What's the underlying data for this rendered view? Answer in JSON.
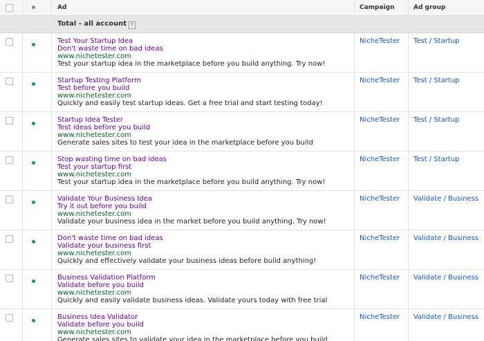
{
  "columns": {
    "ad": "Ad",
    "campaign": "Campaign",
    "ad_group": "Ad group"
  },
  "total": {
    "label": "Total - all account",
    "help": "?"
  },
  "rows": [
    {
      "headline1": "Test Your Startup Idea",
      "headline2": "Don't waste time on bad ideas",
      "url": "www.nichetester.com",
      "description": "Test your startup idea in the marketplace before you build anything. Try now!",
      "campaign": "NicheTester",
      "ad_group": "Test / Startup"
    },
    {
      "headline1": "Startup Testing Platform",
      "headline2": "Test before you build",
      "url": "www.nichetester.com",
      "description": "Quickly and easily test startup ideas. Get a free trial and start testing today!",
      "campaign": "NicheTester",
      "ad_group": "Test / Startup"
    },
    {
      "headline1": "Startup Idea Tester",
      "headline2": "Test ideas before you build",
      "url": "www.nichetester.com",
      "description": "Generate sales sites to test your idea in the marketplace before you build",
      "campaign": "NicheTester",
      "ad_group": "Test / Startup"
    },
    {
      "headline1": "Stop wasting time on bad ideas",
      "headline2": "Test your startup first",
      "url": "www.nichetester.com",
      "description": "Test your startup idea in the marketplace before you build anything. Try now!",
      "campaign": "NicheTester",
      "ad_group": "Test / Startup"
    },
    {
      "headline1": "Validate Your Business Idea",
      "headline2": "Try it out before you build",
      "url": "www.nichetester.com",
      "description": "Validate your business idea in the market before you build anything. Try now!",
      "campaign": "NicheTester",
      "ad_group": "Validate / Business"
    },
    {
      "headline1": "Don't waste time on bad ideas",
      "headline2": "Validate your business first",
      "url": "www.nichetester.com",
      "description": "Quickly and effectively validate your business ideas before build anything!",
      "campaign": "NicheTester",
      "ad_group": "Validate / Business"
    },
    {
      "headline1": "Business Validation Platform",
      "headline2": "Validate before you build",
      "url": "www.nichetester.com",
      "description": "Quickly and easily validate business ideas. Validate yours today with free trial",
      "campaign": "NicheTester",
      "ad_group": "Validate / Business"
    },
    {
      "headline1": "Business Idea Validator",
      "headline2": "Validate before you build",
      "url": "www.nichetester.com",
      "description": "Generate sales sites to validate your idea in the marketplace before you build",
      "campaign": "NicheTester",
      "ad_group": "Validate / Business"
    }
  ],
  "colors": {
    "status_enabled": "#0d9d58",
    "headline": "#660099",
    "display_url": "#006621",
    "link": "#1155cc"
  }
}
